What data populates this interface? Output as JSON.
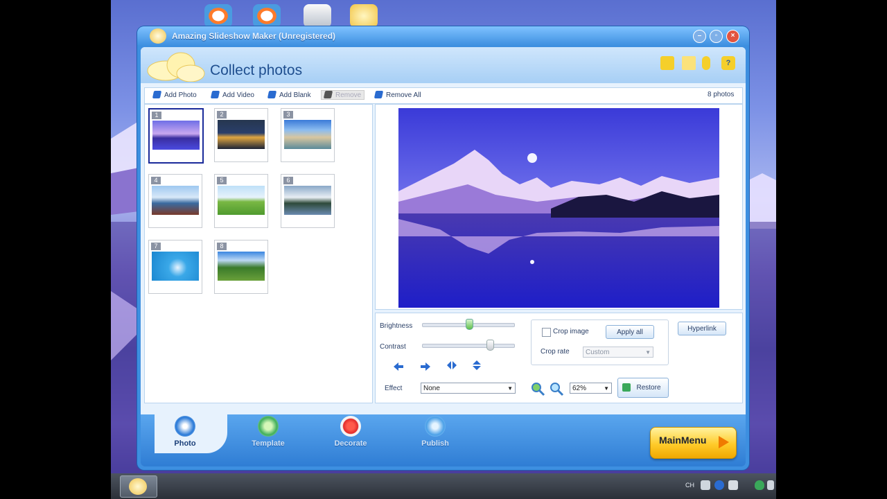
{
  "window": {
    "title": "Amazing Slideshow Maker (Unregistered)"
  },
  "header": {
    "title": "Collect photos"
  },
  "toolbar": {
    "add_photo": "Add Photo",
    "add_video": "Add Video",
    "add_blank": "Add Blank",
    "remove": "Remove",
    "remove_all": "Remove All",
    "count": "8 photos"
  },
  "thumbnails": [
    {
      "num": "1"
    },
    {
      "num": "2"
    },
    {
      "num": "3"
    },
    {
      "num": "4"
    },
    {
      "num": "5"
    },
    {
      "num": "6"
    },
    {
      "num": "7"
    },
    {
      "num": "8"
    }
  ],
  "controls": {
    "brightness_label": "Brightness",
    "contrast_label": "Contrast",
    "effect_label": "Effect",
    "effect_value": "None",
    "crop_image_label": "Crop image",
    "apply_all": "Apply all",
    "crop_rate_label": "Crop rate",
    "crop_rate_value": "Custom",
    "hyperlink": "Hyperlink",
    "zoom_value": "62%",
    "restore": "Restore"
  },
  "nav": {
    "photo": "Photo",
    "template": "Template",
    "decorate": "Decorate",
    "publish": "Publish",
    "main_menu": "MainMenu"
  },
  "taskbar": {
    "lang": "CH"
  }
}
